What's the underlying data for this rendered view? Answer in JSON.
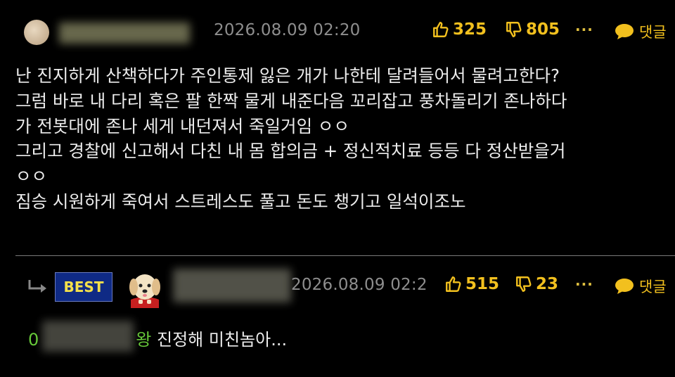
{
  "comment": {
    "date": "2026.08.09 02:20",
    "likes": "325",
    "dislikes": "805",
    "more_label": "···",
    "reply_label": "댓글",
    "body": "난 진지하게 산책하다가 주인통제 잃은 개가 나한테 달려들어서 물려고한다?\n그럼 바로 내 다리 혹은 팔 한짝 물게 내준다음 꼬리잡고 풍차돌리기 존나하다\n가 전봇대에 존나 세게 내던져서 죽일거임 ㅇㅇ\n그리고 경찰에 신고해서 다친 내 몸 합의금 + 정신적치료 등등 다 정산받을거\nㅇㅇ\n짐승 시원하게 죽여서 스트레스도 풀고 돈도 챙기고 일석이조노"
  },
  "best_reply": {
    "badge": "BEST",
    "date": "2026.08.09 02:2",
    "likes": "515",
    "dislikes": "23",
    "more_label": "···",
    "reply_label": "댓글",
    "mention_prefix": "0",
    "mention_suffix": "왕",
    "text": " 진정해 미친놈아..."
  },
  "colors": {
    "background": "#000000",
    "accent": "#f2c01e",
    "mention": "#67c93a",
    "badge_bg": "#0f2a85",
    "badge_text": "#f4e04a"
  },
  "icons": [
    "thumbs-up-icon",
    "thumbs-down-icon",
    "more-icon",
    "speech-bubble-icon",
    "reply-arrow-icon",
    "dog-avatar-icon"
  ]
}
